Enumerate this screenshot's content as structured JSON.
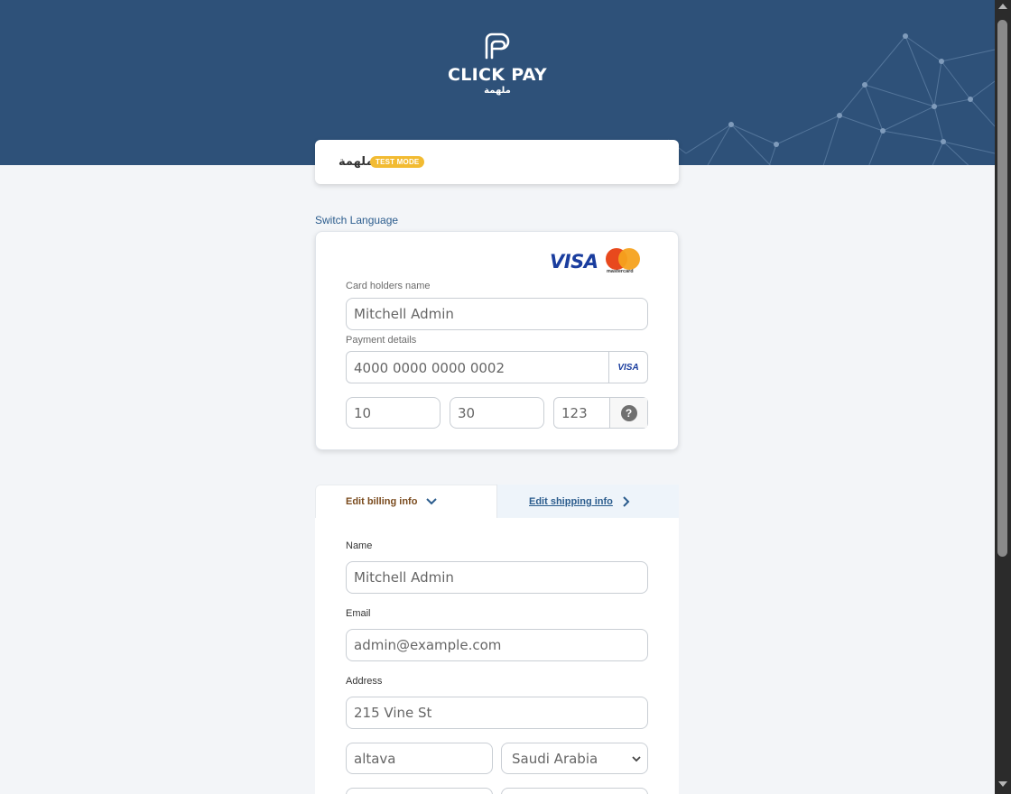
{
  "brand": {
    "name": "CLICK PAY",
    "name_ar": "ملهمة"
  },
  "merchant": {
    "name": "ملهمة",
    "badge": "TEST MODE"
  },
  "switch_language": "Switch Language",
  "card_form": {
    "visa_logo": "VISA",
    "mastercard_text": "mastercard",
    "holder_label": "Card holders name",
    "holder_value": "Mitchell Admin",
    "payment_label": "Payment details",
    "card_number": "4000 0000 0000 0002",
    "card_brand_badge": "VISA",
    "expiry_month": "10",
    "expiry_year": "30",
    "cvv": "123",
    "help_glyph": "?"
  },
  "billing": {
    "tab_billing": "Edit billing info",
    "tab_shipping": "Edit shipping info",
    "name_label": "Name",
    "name_value": "Mitchell Admin",
    "email_label": "Email",
    "email_value": "admin@example.com",
    "address_label": "Address",
    "address_value": "215 Vine St",
    "city_value": "altava",
    "country_value": "Saudi Arabia"
  },
  "colors": {
    "header_bg": "#2e5179",
    "badge_bg": "#f2bb32",
    "link": "#2b5c8d",
    "billing_tab_text": "#7a4b1e",
    "page_bg": "#f3f5f8"
  }
}
